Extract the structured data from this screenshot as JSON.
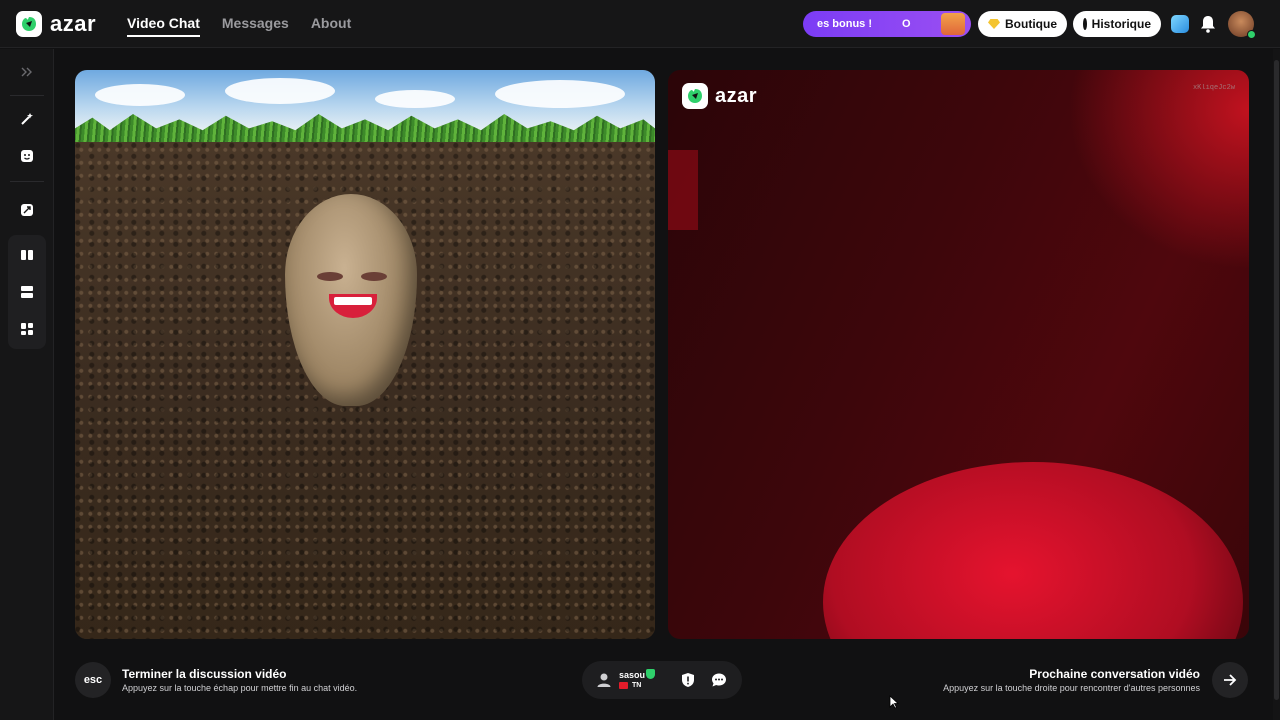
{
  "header": {
    "logo_text": "azar",
    "nav": [
      {
        "label": "Video Chat",
        "active": true
      },
      {
        "label": "Messages",
        "active": false
      },
      {
        "label": "About",
        "active": false
      }
    ],
    "bonus_banner": {
      "text1": "es bonus !",
      "text2": "O"
    },
    "boutique_label": "Boutique",
    "historique_label": "Historique",
    "icons": [
      "gem-icon",
      "bell-icon",
      "avatar"
    ]
  },
  "sidebar": {
    "items": [
      "expand-icon",
      "magic-wand-icon",
      "face-filter-icon",
      "shuffle-icon",
      "layout-side-by-side-icon",
      "layout-stacked-icon",
      "layout-grid-icon"
    ]
  },
  "remote_video": {
    "logo_text": "azar",
    "stream_id": "xKliqeJc2w"
  },
  "bottom": {
    "esc_label": "esc",
    "end_title": "Terminer la discussion vidéo",
    "end_sub": "Appuyez sur la touche échap pour mettre fin au chat vidéo.",
    "username": "sasou",
    "country": "TN",
    "next_title": "Prochaine conversation vidéo",
    "next_sub": "Appuyez sur la touche droite pour rencontrer d'autres personnes"
  },
  "colors": {
    "background": "#111112",
    "accent_purple": "#7b3cf5",
    "brand_green": "#2fd06b",
    "remote_red": "#c1121f"
  }
}
